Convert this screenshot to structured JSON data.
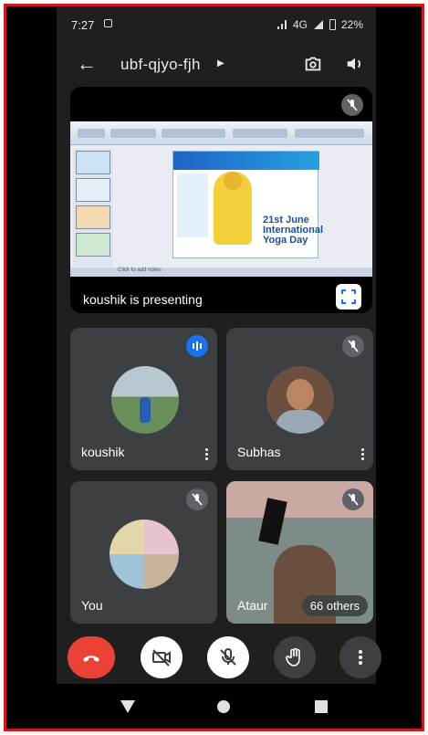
{
  "status_bar": {
    "time": "7:27",
    "network": "4G",
    "battery": "22%"
  },
  "meeting": {
    "code": "ubf-qjyo-fjh"
  },
  "presentation": {
    "label": "koushik is presenting",
    "poster_title": "21st June International Yoga Day",
    "slide_status": "Click to add notes"
  },
  "participants": [
    {
      "name": "koushik",
      "state": "speaking"
    },
    {
      "name": "Subhas",
      "state": "muted"
    },
    {
      "name": "You",
      "state": "muted"
    },
    {
      "name": "Ataur",
      "state": "muted"
    }
  ],
  "others_badge": "66 others",
  "colors": {
    "background": "#1f1f1f",
    "tile": "#3c4043",
    "end_call": "#ea4335",
    "accent": "#1a73e8"
  }
}
